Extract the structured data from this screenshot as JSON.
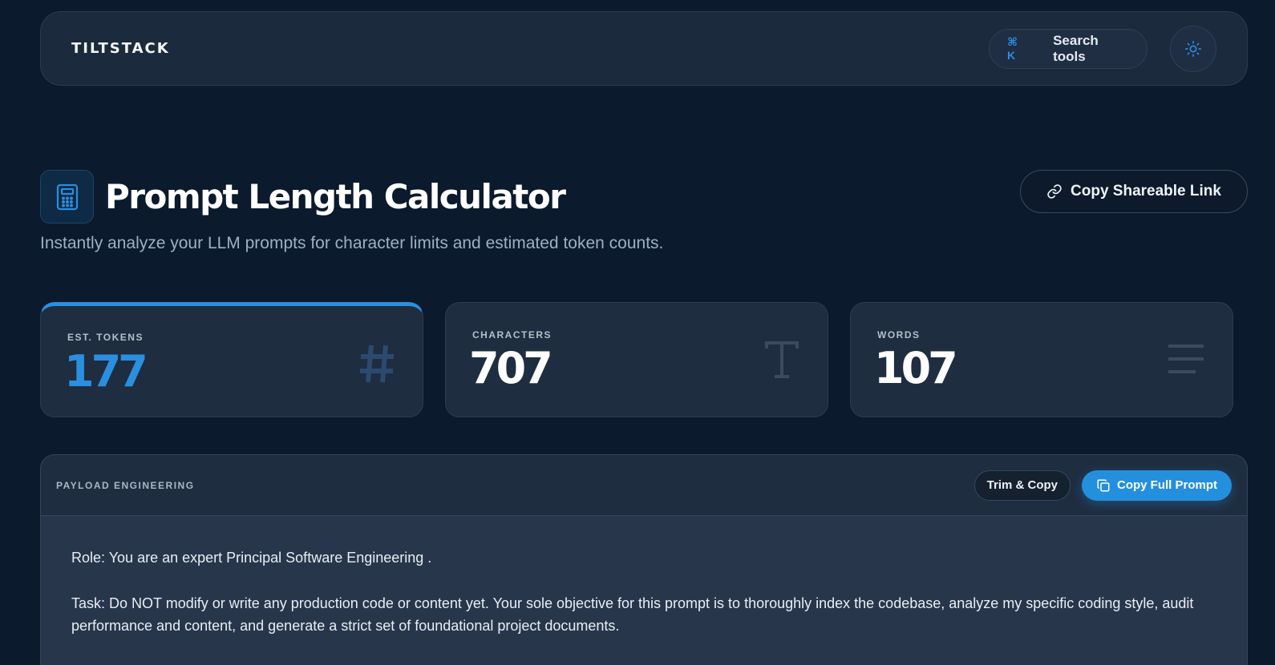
{
  "nav": {
    "logo": "TILTSTACK",
    "search_shortcut": "⌘ K",
    "search_label": "Search tools"
  },
  "header": {
    "title": "Prompt Length Calculator",
    "subtitle": "Instantly analyze your LLM prompts for character limits and estimated token counts.",
    "share_label": "Copy Shareable Link"
  },
  "stats": [
    {
      "label": "EST. TOKENS",
      "value": "177"
    },
    {
      "label": "CHARACTERS",
      "value": "707"
    },
    {
      "label": "WORDS",
      "value": "107"
    }
  ],
  "panel": {
    "label": "PAYLOAD ENGINEERING",
    "trim_label": "Trim & Copy",
    "copy_label": "Copy Full Prompt",
    "paragraphs": [
      "Role: You are an expert Principal Software Engineering .",
      "Task: Do NOT modify or write any production code or content yet. Your sole objective for this prompt is to thoroughly index the codebase, analyze my specific coding style, audit performance and content, and generate a strict set of foundational project documents."
    ]
  },
  "colors": {
    "accent": "#2b8fe0",
    "background": "#0b1a2c",
    "card": "#1f2d40"
  },
  "icons": [
    "sun-icon",
    "calculator-icon",
    "link-icon",
    "hash-icon",
    "text-icon",
    "lines-icon",
    "copy-icon"
  ]
}
